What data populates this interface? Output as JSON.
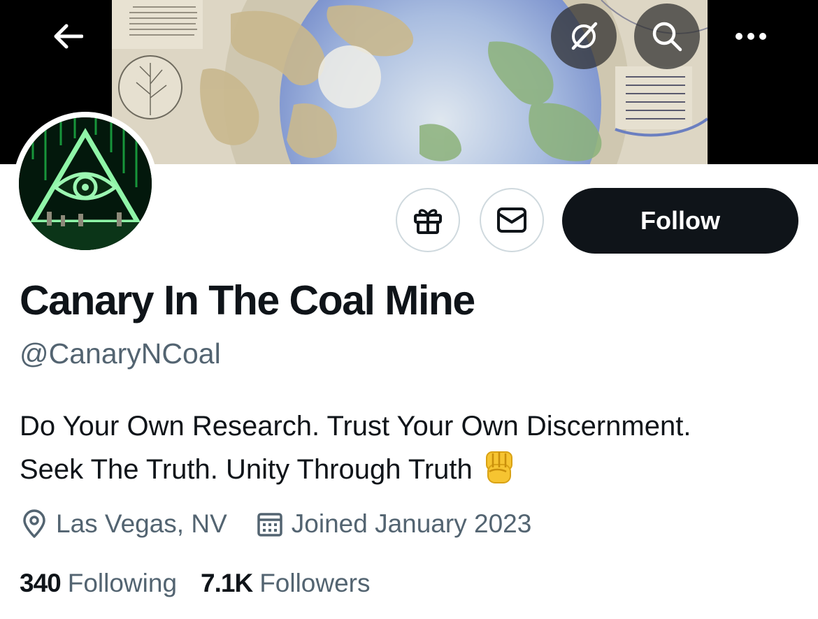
{
  "profile": {
    "display_name": "Canary In The Coal Mine",
    "handle": "@CanaryNCoal",
    "bio_lines": [
      "Do Your Own Research. Trust Your Own Discernment.",
      "Seek The Truth. Unity Through Truth"
    ],
    "bio_emoji": "fist-icon",
    "location": "Las Vegas, NV",
    "joined": "Joined January 2023",
    "following_count": "340",
    "following_label": "Following",
    "followers_count": "7.1K",
    "followers_label": "Followers"
  },
  "actions": {
    "follow_label": "Follow",
    "icons": [
      "back-arrow-icon",
      "grok-icon",
      "search-icon",
      "more-icon",
      "gift-icon",
      "message-icon"
    ]
  },
  "colors": {
    "text_primary": "#0f1419",
    "text_secondary": "#536471",
    "button_border": "#cfd9de",
    "follow_bg": "#0f1419"
  }
}
